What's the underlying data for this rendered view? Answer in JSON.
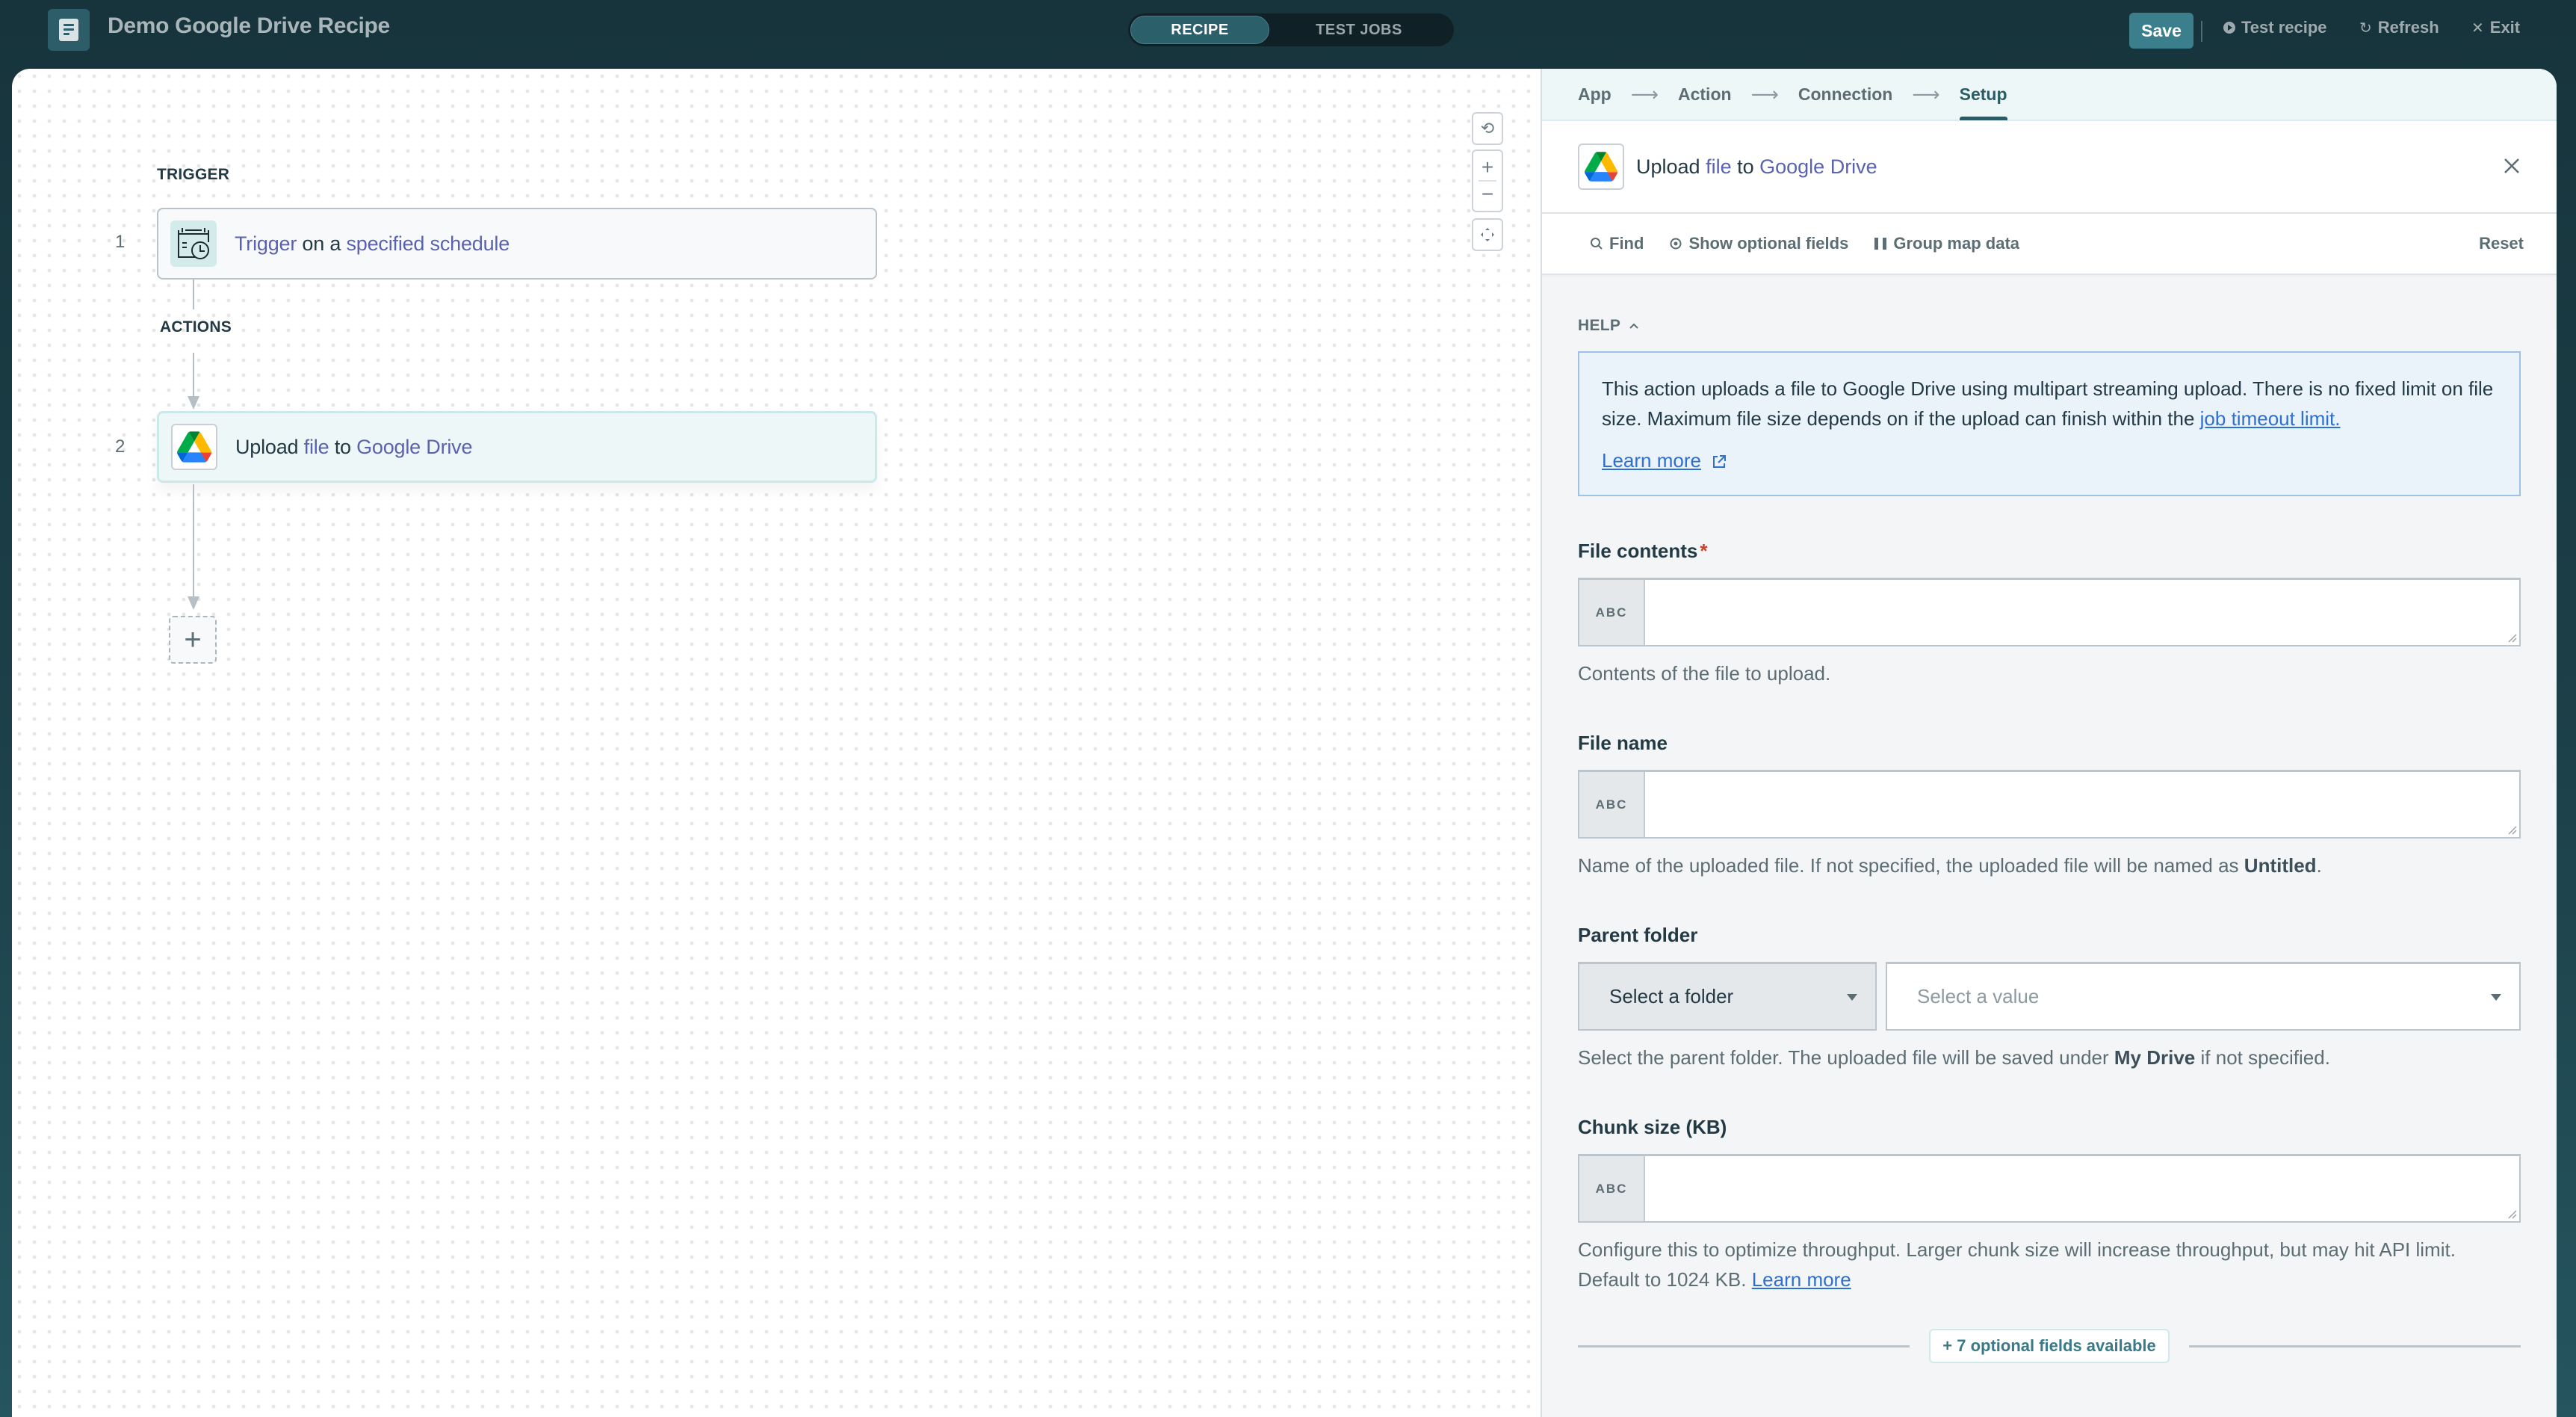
{
  "header": {
    "title": "Demo Google Drive Recipe",
    "tabs": [
      {
        "label": "RECIPE",
        "active": true
      },
      {
        "label": "TEST JOBS",
        "active": false
      }
    ],
    "save_label": "Save",
    "test_recipe_label": "Test recipe",
    "refresh_label": "Refresh",
    "exit_label": "Exit"
  },
  "canvas": {
    "trigger_label": "TRIGGER",
    "actions_label": "ACTIONS",
    "steps": [
      {
        "number": "1",
        "icon": "schedule-icon",
        "parts": [
          "Trigger",
          " on a ",
          "specified schedule"
        ]
      },
      {
        "number": "2",
        "icon": "google-drive-icon",
        "parts": [
          "Upload ",
          "file",
          " to ",
          "Google Drive"
        ]
      }
    ],
    "add_step_label": "+"
  },
  "panel": {
    "wizard": [
      "App",
      "Action",
      "Connection",
      "Setup"
    ],
    "wizard_active": "Setup",
    "action_title": {
      "p1": "Upload ",
      "p2": "file",
      "p3": " to ",
      "p4": "Google Drive"
    },
    "toolbar": {
      "find": "Find",
      "show_optional": "Show optional fields",
      "group_map": "Group map data",
      "reset": "Reset"
    },
    "help": {
      "toggle": "HELP",
      "text": "This action uploads a file to Google Drive using multipart streaming upload. There is no fixed limit on file size. Maximum file size depends on if the upload can finish within the ",
      "link": "job timeout limit.",
      "learn_more": "Learn more"
    },
    "fields": {
      "file_contents": {
        "label": "File contents",
        "required": "*",
        "type_badge": "ABC",
        "value": "",
        "hint": "Contents of the file to upload."
      },
      "file_name": {
        "label": "File name",
        "type_badge": "ABC",
        "value": "",
        "hint_pre": "Name of the uploaded file. If not specified, the uploaded file will be named as ",
        "hint_bold": "Untitled",
        "hint_post": "."
      },
      "parent_folder": {
        "label": "Parent folder",
        "mode": "Select a folder",
        "placeholder": "Select a value",
        "hint_pre": "Select the parent folder. The uploaded file will be saved under ",
        "hint_bold": "My Drive",
        "hint_post": " if not specified."
      },
      "chunk_size": {
        "label": "Chunk size (KB)",
        "type_badge": "ABC",
        "value": "",
        "hint": "Configure this to optimize throughput. Larger chunk size will increase throughput, but may hit API limit. Default to 1024 KB. ",
        "hint_link": "Learn more"
      }
    },
    "optional_fields_label": "+ 7 optional fields available"
  },
  "colors": {
    "header_bg": "#17343c",
    "accent": "#3b7f8d",
    "link": "#2f6fcf",
    "highlight": "#5a62b0",
    "required": "#c9432d"
  }
}
